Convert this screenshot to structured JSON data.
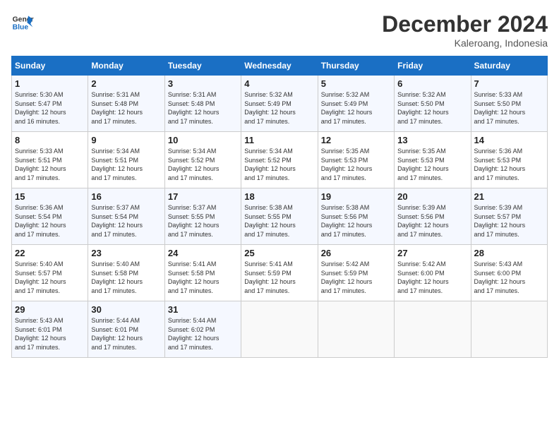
{
  "logo": {
    "line1": "General",
    "line2": "Blue"
  },
  "title": "December 2024",
  "location": "Kaleroang, Indonesia",
  "days_header": [
    "Sunday",
    "Monday",
    "Tuesday",
    "Wednesday",
    "Thursday",
    "Friday",
    "Saturday"
  ],
  "weeks": [
    [
      {
        "day": "1",
        "info": "Sunrise: 5:30 AM\nSunset: 5:47 PM\nDaylight: 12 hours\nand 16 minutes."
      },
      {
        "day": "2",
        "info": "Sunrise: 5:31 AM\nSunset: 5:48 PM\nDaylight: 12 hours\nand 17 minutes."
      },
      {
        "day": "3",
        "info": "Sunrise: 5:31 AM\nSunset: 5:48 PM\nDaylight: 12 hours\nand 17 minutes."
      },
      {
        "day": "4",
        "info": "Sunrise: 5:32 AM\nSunset: 5:49 PM\nDaylight: 12 hours\nand 17 minutes."
      },
      {
        "day": "5",
        "info": "Sunrise: 5:32 AM\nSunset: 5:49 PM\nDaylight: 12 hours\nand 17 minutes."
      },
      {
        "day": "6",
        "info": "Sunrise: 5:32 AM\nSunset: 5:50 PM\nDaylight: 12 hours\nand 17 minutes."
      },
      {
        "day": "7",
        "info": "Sunrise: 5:33 AM\nSunset: 5:50 PM\nDaylight: 12 hours\nand 17 minutes."
      }
    ],
    [
      {
        "day": "8",
        "info": "Sunrise: 5:33 AM\nSunset: 5:51 PM\nDaylight: 12 hours\nand 17 minutes."
      },
      {
        "day": "9",
        "info": "Sunrise: 5:34 AM\nSunset: 5:51 PM\nDaylight: 12 hours\nand 17 minutes."
      },
      {
        "day": "10",
        "info": "Sunrise: 5:34 AM\nSunset: 5:52 PM\nDaylight: 12 hours\nand 17 minutes."
      },
      {
        "day": "11",
        "info": "Sunrise: 5:34 AM\nSunset: 5:52 PM\nDaylight: 12 hours\nand 17 minutes."
      },
      {
        "day": "12",
        "info": "Sunrise: 5:35 AM\nSunset: 5:53 PM\nDaylight: 12 hours\nand 17 minutes."
      },
      {
        "day": "13",
        "info": "Sunrise: 5:35 AM\nSunset: 5:53 PM\nDaylight: 12 hours\nand 17 minutes."
      },
      {
        "day": "14",
        "info": "Sunrise: 5:36 AM\nSunset: 5:53 PM\nDaylight: 12 hours\nand 17 minutes."
      }
    ],
    [
      {
        "day": "15",
        "info": "Sunrise: 5:36 AM\nSunset: 5:54 PM\nDaylight: 12 hours\nand 17 minutes."
      },
      {
        "day": "16",
        "info": "Sunrise: 5:37 AM\nSunset: 5:54 PM\nDaylight: 12 hours\nand 17 minutes."
      },
      {
        "day": "17",
        "info": "Sunrise: 5:37 AM\nSunset: 5:55 PM\nDaylight: 12 hours\nand 17 minutes."
      },
      {
        "day": "18",
        "info": "Sunrise: 5:38 AM\nSunset: 5:55 PM\nDaylight: 12 hours\nand 17 minutes."
      },
      {
        "day": "19",
        "info": "Sunrise: 5:38 AM\nSunset: 5:56 PM\nDaylight: 12 hours\nand 17 minutes."
      },
      {
        "day": "20",
        "info": "Sunrise: 5:39 AM\nSunset: 5:56 PM\nDaylight: 12 hours\nand 17 minutes."
      },
      {
        "day": "21",
        "info": "Sunrise: 5:39 AM\nSunset: 5:57 PM\nDaylight: 12 hours\nand 17 minutes."
      }
    ],
    [
      {
        "day": "22",
        "info": "Sunrise: 5:40 AM\nSunset: 5:57 PM\nDaylight: 12 hours\nand 17 minutes."
      },
      {
        "day": "23",
        "info": "Sunrise: 5:40 AM\nSunset: 5:58 PM\nDaylight: 12 hours\nand 17 minutes."
      },
      {
        "day": "24",
        "info": "Sunrise: 5:41 AM\nSunset: 5:58 PM\nDaylight: 12 hours\nand 17 minutes."
      },
      {
        "day": "25",
        "info": "Sunrise: 5:41 AM\nSunset: 5:59 PM\nDaylight: 12 hours\nand 17 minutes."
      },
      {
        "day": "26",
        "info": "Sunrise: 5:42 AM\nSunset: 5:59 PM\nDaylight: 12 hours\nand 17 minutes."
      },
      {
        "day": "27",
        "info": "Sunrise: 5:42 AM\nSunset: 6:00 PM\nDaylight: 12 hours\nand 17 minutes."
      },
      {
        "day": "28",
        "info": "Sunrise: 5:43 AM\nSunset: 6:00 PM\nDaylight: 12 hours\nand 17 minutes."
      }
    ],
    [
      {
        "day": "29",
        "info": "Sunrise: 5:43 AM\nSunset: 6:01 PM\nDaylight: 12 hours\nand 17 minutes."
      },
      {
        "day": "30",
        "info": "Sunrise: 5:44 AM\nSunset: 6:01 PM\nDaylight: 12 hours\nand 17 minutes."
      },
      {
        "day": "31",
        "info": "Sunrise: 5:44 AM\nSunset: 6:02 PM\nDaylight: 12 hours\nand 17 minutes."
      },
      {
        "day": "",
        "info": ""
      },
      {
        "day": "",
        "info": ""
      },
      {
        "day": "",
        "info": ""
      },
      {
        "day": "",
        "info": ""
      }
    ]
  ]
}
